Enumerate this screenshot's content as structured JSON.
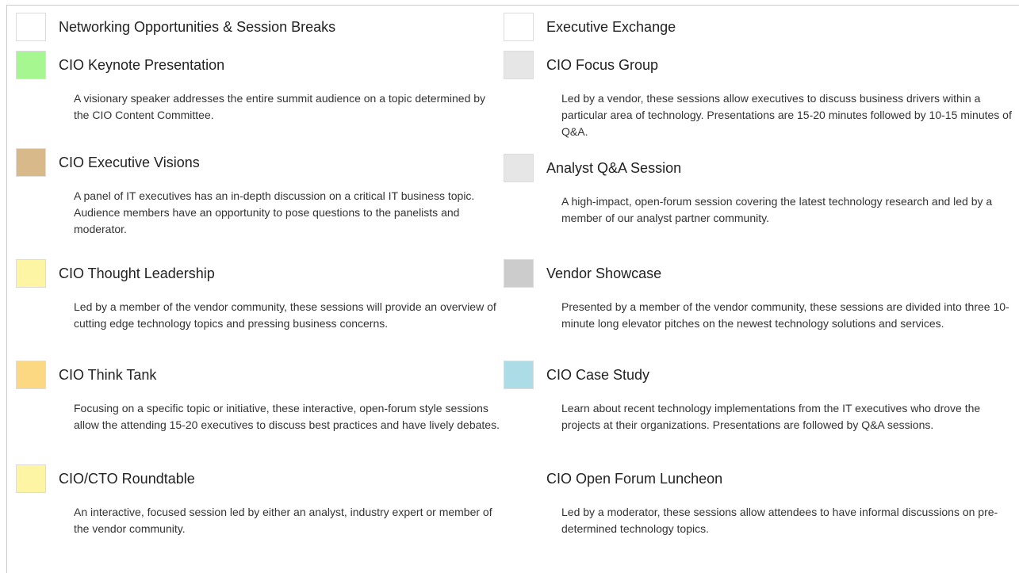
{
  "left_items": [
    {
      "title": "Networking Opportunities & Session Breaks",
      "description": "",
      "color": "#ffffff"
    },
    {
      "title": "CIO Keynote Presentation",
      "description": "A visionary speaker addresses the entire summit audience on a topic determined by the CIO Content Committee.",
      "color": "#a7f791"
    },
    {
      "title": "CIO Executive Visions",
      "description": "A panel of IT executives has an in-depth discussion on a critical IT business topic. Audience members have an opportunity to pose questions to the panelists and moderator.",
      "color": "#d8b98a"
    },
    {
      "title": "CIO Thought Leadership",
      "description": "Led by a member of the vendor community, these sessions will provide an overview of cutting edge technology topics and pressing business concerns.",
      "color": "#fdf5a4"
    },
    {
      "title": "CIO Think Tank",
      "description": "Focusing on a specific topic or initiative, these interactive, open-forum style sessions allow the attending 15-20 executives to discuss best practices and have lively debates.",
      "color": "#fdd882"
    },
    {
      "title": "CIO/CTO Roundtable",
      "description": "An interactive, focused session led by either an analyst, industry expert or member of the vendor community.",
      "color": "#fdf5a4"
    }
  ],
  "right_items": [
    {
      "title": "Executive Exchange",
      "description": "",
      "color": "#ffffff"
    },
    {
      "title": "CIO Focus Group",
      "description": "Led by a vendor, these sessions allow executives to discuss business drivers within a particular area of technology. Presentations are 15-20 minutes followed by 10-15 minutes of Q&A.",
      "color": "#e6e6e6"
    },
    {
      "title": "Analyst Q&A Session",
      "description": "A high-impact, open-forum session covering the latest technology research and led by a member of our analyst partner community.",
      "color": "#e6e6e6"
    },
    {
      "title": "Vendor Showcase",
      "description": "Presented by a member of the vendor community, these sessions are divided into three 10-minute long elevator pitches on the newest technology solutions and services.",
      "color": "#cccccc"
    },
    {
      "title": "CIO Case Study",
      "description": "Learn about recent technology implementations from the IT executives who drove the projects at their organizations. Presentations are followed by Q&A sessions.",
      "color": "#acdde6"
    },
    {
      "title": "CIO Open Forum Luncheon",
      "description": "Led by a moderator, these sessions allow attendees to have informal discussions on pre-determined technology topics.",
      "color": "#ffffff"
    }
  ]
}
